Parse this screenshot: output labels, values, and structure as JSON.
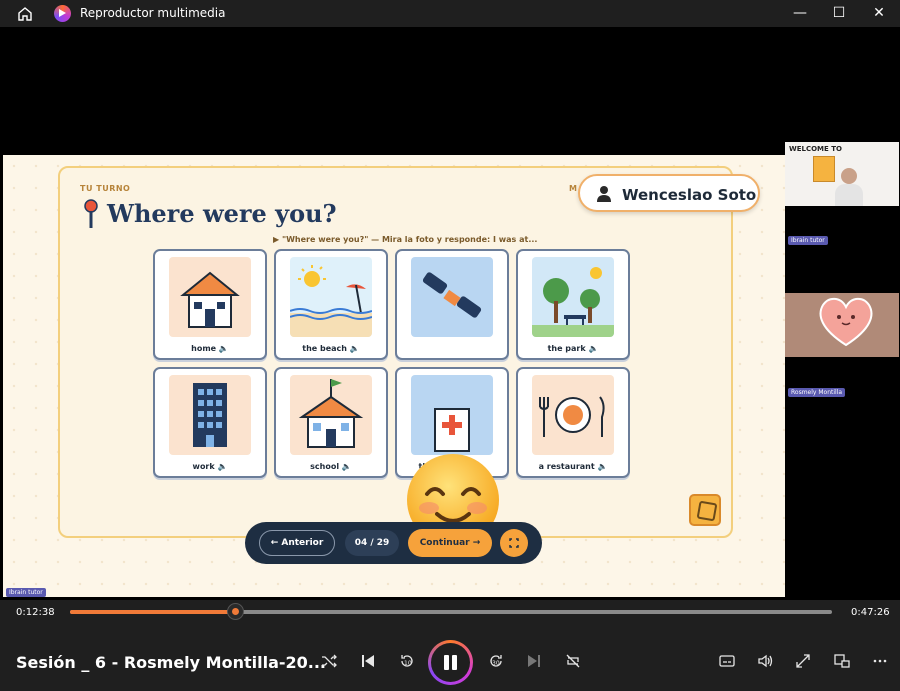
{
  "window": {
    "title": "Reproductor multimedia",
    "minimize": "—",
    "maximize": "☐",
    "close": "✕"
  },
  "lesson": {
    "section": "TU TURNO",
    "m_label": "M",
    "title": "Where were you?",
    "instruction": "▶ \"Where were you?\" — Mira la foto y responde: I was at...",
    "student_name": "Wenceslao Soto",
    "tiles": [
      {
        "label": "home 🔈",
        "icon": "house-icon"
      },
      {
        "label": "the beach 🔈",
        "icon": "beach-icon"
      },
      {
        "label": "",
        "icon": "airplane-icon"
      },
      {
        "label": "the park 🔈",
        "icon": "park-icon"
      },
      {
        "label": "work 🔈",
        "icon": "building-icon"
      },
      {
        "label": "school 🔈",
        "icon": "school-icon"
      },
      {
        "label": "the doctor's 🔈",
        "icon": "doctor-icon"
      },
      {
        "label": "a restaurant 🔈",
        "icon": "restaurant-icon"
      }
    ],
    "nav": {
      "prev": "← Anterior",
      "counter": "04 / 29",
      "next": "Continuar →",
      "fullscreen": "⛶"
    }
  },
  "participants": [
    {
      "name": "Ibrain tutor",
      "banner": "WELCOME TO"
    },
    {
      "name": "Rosmely Montilla"
    }
  ],
  "self_tag": "Ibrain tutor",
  "player": {
    "current_time": "0:12:38",
    "total_time": "0:47:26",
    "progress": 0.217,
    "media_title": "Sesión _ 6 - Rosmely Montilla-20...",
    "skip_back": "10",
    "skip_forward": "30"
  },
  "colors": {
    "accent": "#f07a38",
    "title_navy": "#233a5e",
    "tile_border": "#6b7d99",
    "orange_btn": "#f6a23b"
  }
}
